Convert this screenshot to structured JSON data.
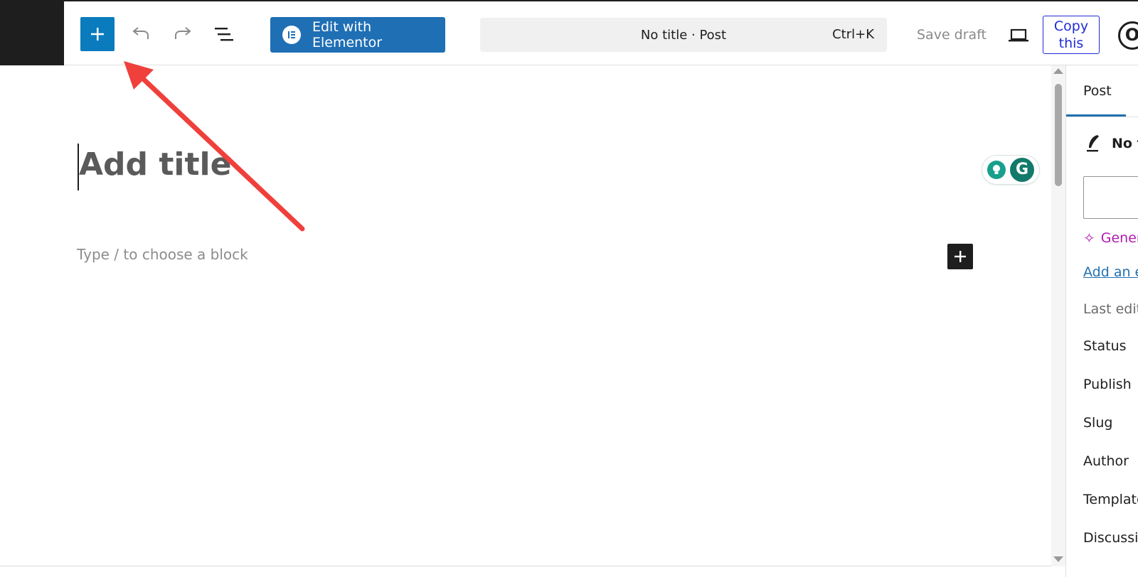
{
  "toolbar": {
    "inserter_icon": "plus-icon",
    "undo_icon": "undo-icon",
    "redo_icon": "redo-icon",
    "outline_icon": "document-overview-icon",
    "elementor_label": "Edit with Elementor",
    "document_title": "No title · Post",
    "shortcut": "Ctrl+K",
    "save_draft": "Save draft",
    "copy_label": "Copy this",
    "settings_glyph": "O"
  },
  "editor": {
    "title_placeholder": "Add title",
    "block_placeholder": "Type / to choose a block",
    "grammarly_letter": "G"
  },
  "sidebar": {
    "tab_post": "Post",
    "post_name": "No title",
    "generate_label": "Generate excerpt",
    "add_excerpt": "Add an excerpt",
    "last_edited": "Last edited",
    "rows": [
      "Status",
      "Publish",
      "Slug",
      "Author",
      "Template",
      "Discussion"
    ]
  },
  "colors": {
    "accent": "#0a7bbd",
    "elementor": "#1f6fb5",
    "copy_border": "#1f2bd6",
    "annotation_arrow": "#f0403c"
  }
}
